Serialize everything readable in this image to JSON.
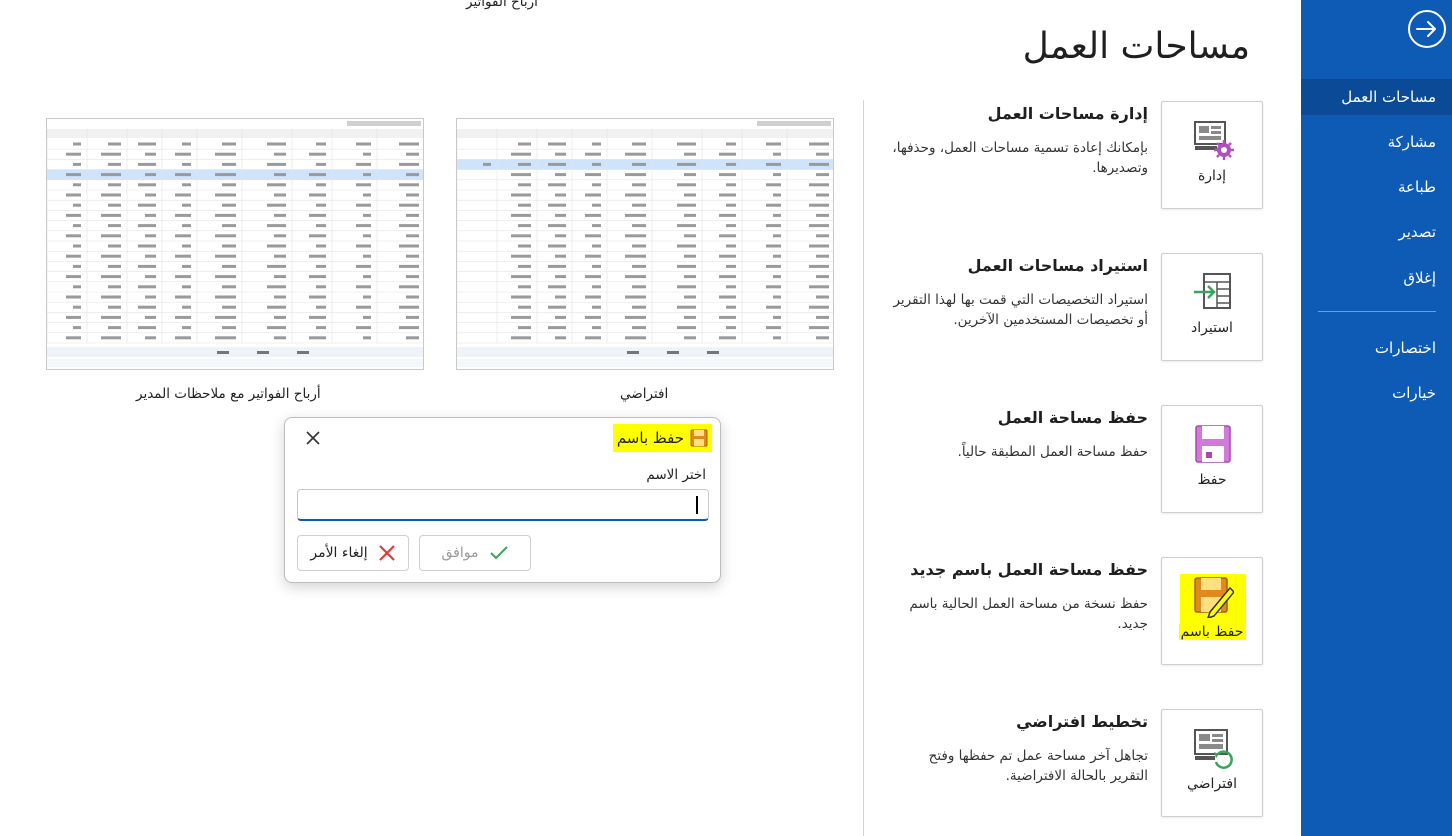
{
  "sidebar": {
    "back_icon": "arrow-right-circle-icon",
    "items": [
      {
        "label": "مساحات العمل",
        "active": true
      },
      {
        "label": "مشاركة"
      },
      {
        "label": "طباعة"
      },
      {
        "label": "تصدير"
      },
      {
        "label": "إغلاق"
      },
      {
        "label": "اختصارات"
      },
      {
        "label": "خيارات"
      }
    ]
  },
  "page": {
    "title": "مساحات العمل"
  },
  "actions": [
    {
      "button_label": "إدارة",
      "title": "إدارة مساحات العمل",
      "description": "بإمكانك إعادة تسمية مساحات العمل، وحذفها، وتصديرها.",
      "icon": "manage-workspace-icon"
    },
    {
      "button_label": "استيراد",
      "title": "استيراد مساحات العمل",
      "description": "استيراد التخصيصات التي قمت بها لهذا التقرير أو تخصيصات المستخدمين الآخرين.",
      "icon": "import-icon"
    },
    {
      "button_label": "حفظ",
      "title": "حفظ مساحة العمل",
      "description": "حفظ مساحة العمل المطبقة حالياً.",
      "icon": "save-icon"
    },
    {
      "button_label": "حفظ باسم",
      "title": "حفظ مساحة العمل باسم جديد",
      "description": "حفظ نسخة من مساحة العمل الحالية باسم جديد.",
      "icon": "save-as-icon"
    },
    {
      "button_label": "افتراضي",
      "title": "تخطيط افتراضي",
      "description": "تجاهل آخر مساحة عمل تم حفظها وفتح التقرير بالحالة الافتراضية.",
      "icon": "default-layout-icon"
    }
  ],
  "gallery": {
    "top_label": "أرباح الفواتير",
    "items": [
      {
        "label": "افتراضي"
      },
      {
        "label": "أرباح الفواتير مع ملاحظات المدير"
      }
    ]
  },
  "dialog": {
    "title": "حفظ باسم",
    "name_label": "اختر الاسم",
    "name_value": "",
    "ok_label": "موافق",
    "cancel_label": "إلغاء الأمر"
  },
  "colors": {
    "sidebar": "#0e5bb5",
    "sidebar_active": "#0a4a97",
    "highlight": "#ffff00",
    "save_purple": "#c05bc8",
    "save_orange": "#e0891c"
  }
}
